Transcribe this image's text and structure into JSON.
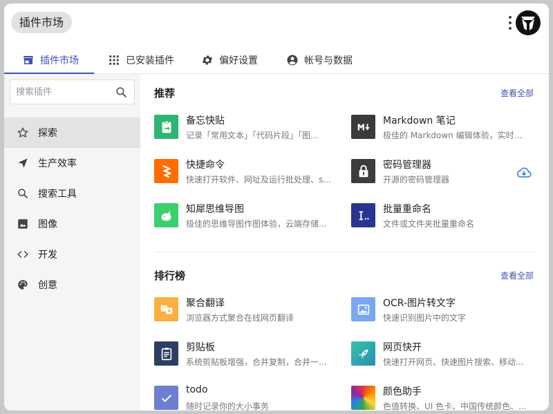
{
  "title": "插件市场",
  "tabs": [
    {
      "label": "插件市场",
      "icon": "store-icon",
      "active": true
    },
    {
      "label": "已安装插件",
      "icon": "apps-grid-icon",
      "active": false
    },
    {
      "label": "偏好设置",
      "icon": "gear-icon",
      "active": false
    },
    {
      "label": "帐号与数据",
      "icon": "account-icon",
      "active": false
    }
  ],
  "search": {
    "placeholder": "搜索插件"
  },
  "sidebar": {
    "items": [
      {
        "label": "探索",
        "icon": "star-outline-icon",
        "active": true
      },
      {
        "label": "生产效率",
        "icon": "send-icon",
        "active": false
      },
      {
        "label": "搜索工具",
        "icon": "search-icon",
        "active": false
      },
      {
        "label": "图像",
        "icon": "image-icon",
        "active": false
      },
      {
        "label": "开发",
        "icon": "code-icon",
        "active": false
      },
      {
        "label": "创意",
        "icon": "palette-icon",
        "active": false
      }
    ]
  },
  "sections": {
    "recommended": {
      "title": "推荐",
      "view_all": "查看全部",
      "plugins": [
        {
          "name": "备忘快贴",
          "desc": "记录「常用文本」「代码片段」「图...",
          "icon": "clipboard-paste-icon",
          "color": "#2bb673"
        },
        {
          "name": "Markdown 笔记",
          "desc": "极佳的 Markdown 编辑体验，实时预...",
          "icon": "markdown-icon",
          "color": "#3a3a3a"
        },
        {
          "name": "快捷命令",
          "desc": "快速打开软件、网址及运行批处理、s...",
          "icon": "lightning-icon",
          "color": "#ff6d00"
        },
        {
          "name": "密码管理器",
          "desc": "开源的密码管理器",
          "icon": "lock-icon",
          "color": "#3d3d3d"
        },
        {
          "name": "知犀思维导图",
          "desc": "极佳的思维导图作图体验，云端存储...",
          "icon": "rhino-icon",
          "color": "#3ccf6e"
        },
        {
          "name": "批量重命名",
          "desc": "文件或文件夹批量重命名",
          "icon": "rename-icon",
          "color": "#283593"
        }
      ]
    },
    "ranking": {
      "title": "排行榜",
      "view_all": "查看全部",
      "plugins": [
        {
          "name": "聚合翻译",
          "desc": "浏览器方式聚合在线网页翻译",
          "icon": "translate-icon",
          "color": "#fbb040"
        },
        {
          "name": "OCR-图片转文字",
          "desc": "快速识别图片中的文字",
          "icon": "ocr-image-icon",
          "color": "#7aa7f0"
        },
        {
          "name": "剪贴板",
          "desc": "系统剪贴板增强，合并复制，合并一...",
          "icon": "clipboard-icon",
          "color": "#2c3e63"
        },
        {
          "name": "网页快开",
          "desc": "快速打开网页、快速图片搜索、移动...",
          "icon": "rocket-icon",
          "color": "#2bb3a3"
        },
        {
          "name": "todo",
          "desc": "随时记录你的大小事务",
          "icon": "check-icon",
          "color": "#6c7fd1"
        },
        {
          "name": "颜色助手",
          "desc": "色值转换、UI 色卡、中国传统颜色、...",
          "icon": "color-wheel-icon",
          "color": "#e53935"
        }
      ]
    }
  },
  "colors": {
    "accent": "#3f51b5"
  }
}
